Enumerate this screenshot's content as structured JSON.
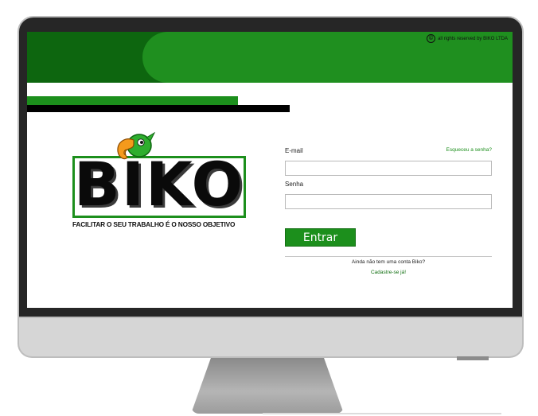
{
  "header": {
    "copyright_symbol": "©",
    "copyright_text": "all rights reserved by BIKO LTDA"
  },
  "logo": {
    "brand": "BIKO",
    "tagline": "FACILITAR O SEU TRABALHO É O NOSSO OBJETIVO",
    "icon": "parrot-icon"
  },
  "login": {
    "email_label": "E-mail",
    "forgot_link": "Esqueceu a senha?",
    "email_value": "",
    "password_label": "Senha",
    "password_value": "",
    "submit_label": "Entrar",
    "no_account_text": "Ainda não tem uma conta Biko?",
    "signup_link": "Cadastre-se já!"
  },
  "colors": {
    "brand_green": "#1c8f1c",
    "dark_green": "#0d660f",
    "monitor_frame": "#262626",
    "monitor_chin": "#d6d6d6"
  }
}
